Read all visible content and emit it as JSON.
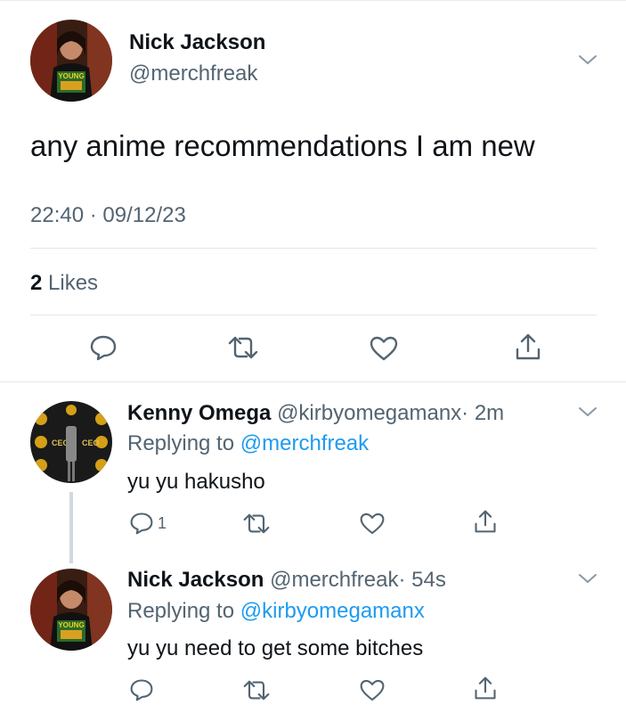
{
  "main_tweet": {
    "author_name": "Nick Jackson",
    "author_handle": "@merchfreak",
    "text": "any anime recommendations I am new",
    "timestamp": "22:40 · 09/12/23",
    "likes_count": "2",
    "likes_label": "Likes",
    "avatar_shirt_text": "YOUNG"
  },
  "replies": [
    {
      "author_name": "Kenny Omega",
      "author_handle": "@kirbyomegamanx",
      "time": "· 2m",
      "replying_prefix": "Replying to",
      "replying_to": "@merchfreak",
      "text": "yu yu hakusho",
      "reply_count": "1",
      "avatar_logo_text": "CEO"
    },
    {
      "author_name": "Nick Jackson",
      "author_handle": "@merchfreak",
      "time": "· 54s",
      "replying_prefix": "Replying to",
      "replying_to": "@kirbyomegamanx",
      "text": "yu yu need to get some bitches",
      "reply_count": "",
      "avatar_shirt_text": "YOUNG"
    }
  ],
  "colors": {
    "text_primary": "#0f1419",
    "text_secondary": "#536471",
    "link": "#1d9bf0",
    "divider": "#e1e8ed"
  },
  "icons": [
    "chevron-down-icon",
    "reply-icon",
    "retweet-icon",
    "like-icon",
    "share-icon"
  ]
}
